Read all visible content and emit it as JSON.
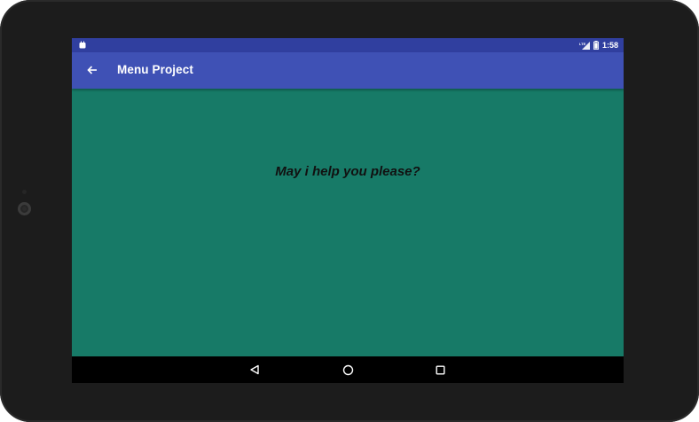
{
  "status_bar": {
    "time": "1:58",
    "network_label": "LTE",
    "left_icon": "android-notification-icon",
    "battery_icon": "battery-icon",
    "signal_icon": "signal-icon"
  },
  "app_bar": {
    "title": "Menu Project",
    "back_icon": "arrow-back-icon",
    "color": "#3f51b5",
    "status_color": "#303f9f"
  },
  "content": {
    "message": "May i help you please?",
    "background_color": "#177a67"
  },
  "nav_bar": {
    "buttons": [
      "back-triangle-icon",
      "home-circle-icon",
      "recents-square-icon"
    ]
  }
}
